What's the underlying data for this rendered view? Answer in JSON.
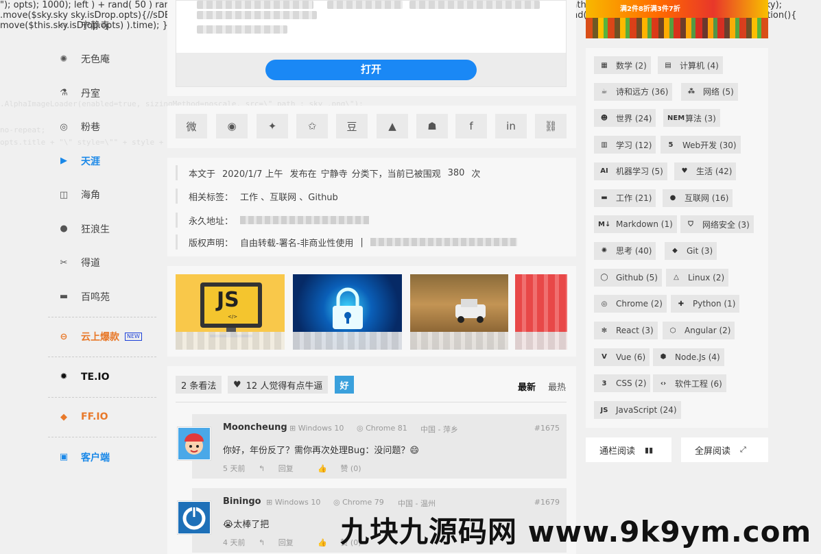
{
  "nav": {
    "items": [
      {
        "label": "宁静寺",
        "icon": "‹›"
      },
      {
        "label": "无色庵",
        "icon": "✺"
      },
      {
        "label": "丹室",
        "icon": "⚗"
      },
      {
        "label": "粉巷",
        "icon": "◎"
      },
      {
        "label": "天涯",
        "icon": "▶"
      },
      {
        "label": "海角",
        "icon": "◫"
      },
      {
        "label": "狂浪生",
        "icon": "●"
      },
      {
        "label": "得道",
        "icon": "✂"
      },
      {
        "label": "百鸣苑",
        "icon": "▬"
      }
    ],
    "promo": {
      "label": "云上爆款",
      "badge": "NEW",
      "icon": "⊖"
    },
    "te": {
      "label": "TE.IO",
      "icon": "✹"
    },
    "ff": {
      "label": "FF.IO",
      "icon": "◆"
    },
    "client": {
      "label": "客户端",
      "icon": "▣"
    }
  },
  "open_card": {
    "button_label": "打开"
  },
  "share": {
    "icons": [
      "微",
      "◉",
      "✦",
      "✩",
      "豆",
      "▲",
      "☗",
      "f",
      "in",
      "⛓"
    ]
  },
  "meta": {
    "prefix": "本文于",
    "date": "2020/1/7 上午",
    "posted_in": "发布在",
    "category": "宁静寺",
    "views_text": "分类下，当前已被围观",
    "views": "380",
    "views_unit": "次",
    "tags_label": "相关标签：",
    "tags": "工作 、互联网 、Github",
    "permalink_label": "永久地址：",
    "license_label": "版权声明：",
    "license": "自由转载-署名-非商业性使用",
    "separator": "|"
  },
  "related": {
    "js_label": "JS",
    "js_tag": "</>"
  },
  "comments": {
    "count_label": "2 条看法",
    "likes_label": "12 人觉得有点牛逼",
    "good_label": "好",
    "sort_newest": "最新",
    "sort_hottest": "最热",
    "list": [
      {
        "name": "Mooncheung",
        "os": "Windows 10",
        "browser": "Chrome 81",
        "location": "中国 - 萍乡",
        "number": "#1675",
        "text": "你好，年份反了？需你再次处理Bug：没问题？😄",
        "time": "5 天前",
        "reply": "回复",
        "like": "赞 (0)"
      },
      {
        "name": "Biningo",
        "os": "Windows 10",
        "browser": "Chrome 79",
        "location": "中国 - 温州",
        "number": "#1679",
        "text": "😭太棒了把",
        "time": "4 天前",
        "reply": "回复",
        "like": "赞 (0)"
      }
    ]
  },
  "tags_cloud": [
    {
      "label": "数学 (2)",
      "icon": "▦"
    },
    {
      "label": "计算机 (4)",
      "icon": "▤"
    },
    {
      "label": "诗和远方 (36)",
      "icon": "☕"
    },
    {
      "label": "网络 (5)",
      "icon": "⁂"
    },
    {
      "label": "世界 (24)",
      "icon": "☻"
    },
    {
      "label": "算法 (3)",
      "icon": "NEM"
    },
    {
      "label": "学习 (12)",
      "icon": "▥"
    },
    {
      "label": "Web开发 (30)",
      "icon": "5"
    },
    {
      "label": "机器学习 (5)",
      "icon": "AI"
    },
    {
      "label": "生活 (42)",
      "icon": "♥"
    },
    {
      "label": "工作 (21)",
      "icon": "▬"
    },
    {
      "label": "互联网 (16)",
      "icon": "●"
    },
    {
      "label": "Markdown (1)",
      "icon": "M↓"
    },
    {
      "label": "网络安全 (3)",
      "icon": "⛉"
    },
    {
      "label": "思考 (40)",
      "icon": "✺"
    },
    {
      "label": "Git (3)",
      "icon": "◆"
    },
    {
      "label": "Github (5)",
      "icon": "◯"
    },
    {
      "label": "Linux (2)",
      "icon": "△"
    },
    {
      "label": "Chrome (2)",
      "icon": "◎"
    },
    {
      "label": "Python (1)",
      "icon": "✚"
    },
    {
      "label": "React (3)",
      "icon": "✻"
    },
    {
      "label": "Angular (2)",
      "icon": "⬡"
    },
    {
      "label": "Vue (6)",
      "icon": "V"
    },
    {
      "label": "Node.Js (4)",
      "icon": "⬢"
    },
    {
      "label": "CSS (2)",
      "icon": "3"
    },
    {
      "label": "软件工程 (6)",
      "icon": "‹›"
    },
    {
      "label": "JavaScript (24)",
      "icon": "JS"
    }
  ],
  "reading": {
    "column": "通栏阅读",
    "column_icon": "▮▮",
    "fullscreen": "全屏阅读",
    "fullscreen_icon": "⤢"
  },
  "watermark": "九块九源码网 www.9k9ym.com",
  "ad": {
    "text": "满2件8折满3件7折"
  }
}
